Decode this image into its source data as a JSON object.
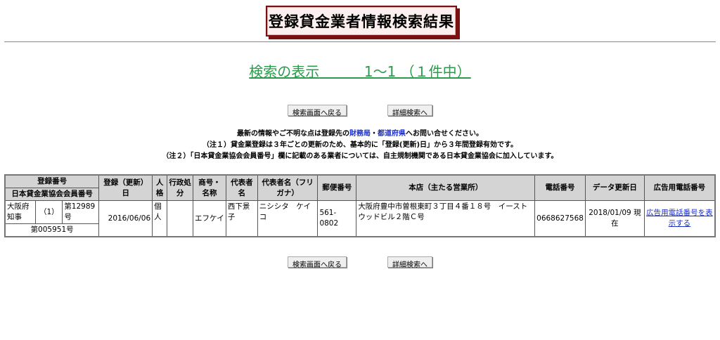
{
  "page_title": "登録貸金業者情報検索結果",
  "result_label": "検索の表示",
  "result_range": "1～1 （１件中）",
  "buttons": {
    "back": "検索画面へ戻る",
    "detail": "詳細検索へ"
  },
  "notes": {
    "line1_pre": "最新の情報やご不明な点は登録先の",
    "link1": "財務局",
    "sep": "・",
    "link2": "都道府県",
    "line1_post": "へお問い合せください。",
    "line2": "（注１）貸金業登録は３年ごとの更新のため、基本的に「登録(更新)日」から３年間登録有効です。",
    "line3": "（注２）「日本貸金業協会会員番号」欄に記載のある業者については、自主規制機関である日本貸金業協会に加入しています。"
  },
  "table": {
    "headers": {
      "reg_no": "登録番号",
      "member_no": "日本貸金業協会会員番号",
      "reg_date": "登録（更新）日",
      "person": "人格",
      "admin": "行政処分",
      "trade_name": "商号・名称",
      "rep": "代表者名",
      "rep_kana": "代表者名（フリガナ）",
      "postal": "郵便番号",
      "hq": "本店（主たる営業所）",
      "phone": "電話番号",
      "data_date": "データ更新日",
      "ad_phone": "広告用電話番号"
    },
    "row": {
      "authority": "大阪府知事",
      "renewal": "（1）",
      "number": "第12989号",
      "member_no": "第005951号",
      "reg_date": "2016/06/06",
      "person": "個人",
      "admin": "",
      "trade_name": "エフケイ",
      "rep": "西下景子",
      "rep_kana": "ニシシタ　ケイコ",
      "postal": "561-0802",
      "hq": "大阪府豊中市曽根東町３丁目４番１８号　イーストウッドビル２階Ｃ号",
      "phone": "0668627568",
      "data_date": "2018/01/09 現在",
      "ad_phone_link": "広告用電話番号を表示する"
    }
  }
}
